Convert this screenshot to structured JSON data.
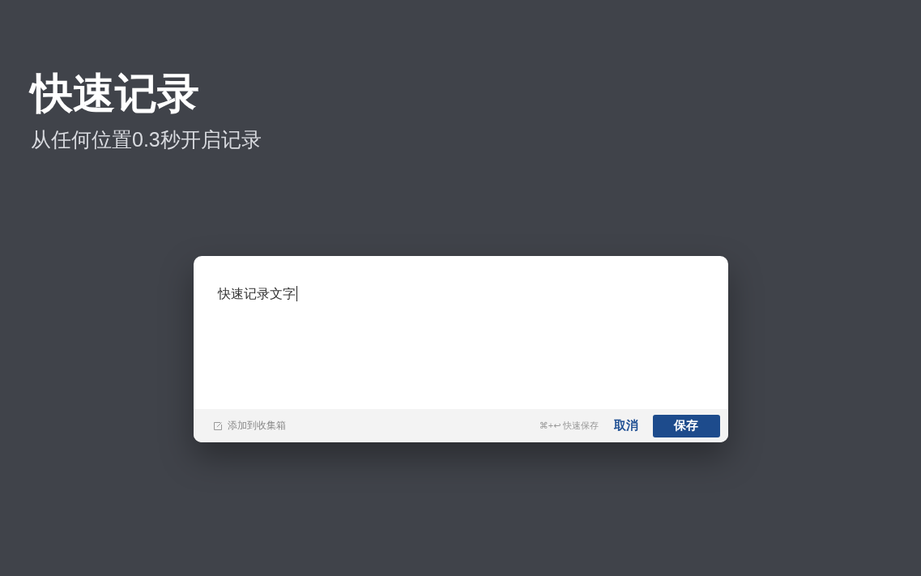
{
  "hero": {
    "title": "快速记录",
    "subtitle": "从任何位置0.3秒开启记录"
  },
  "quick_note": {
    "value": "快速记录文字",
    "focused": true,
    "collection_link": "添加到收集箱",
    "shortcut_hint": "⌘+↩ 快速保存",
    "buttons": [
      {
        "label": "取消",
        "kind": "link"
      },
      {
        "label": "保存",
        "kind": "primary"
      }
    ]
  }
}
